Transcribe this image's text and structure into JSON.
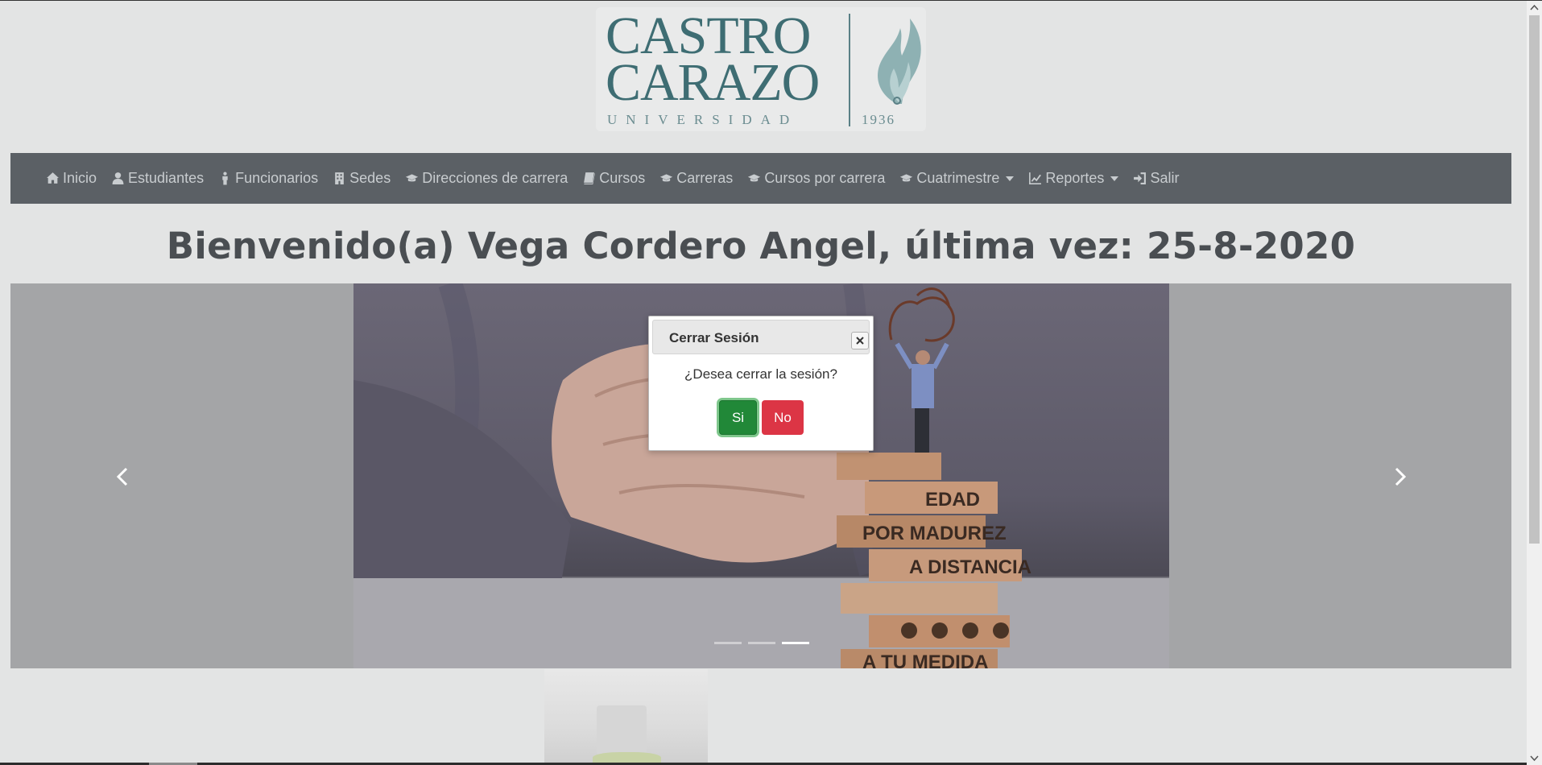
{
  "logo": {
    "line1": "CASTRO",
    "line2": "CARAZO",
    "subtitle": "UNIVERSIDAD",
    "year": "1936"
  },
  "nav": {
    "items": [
      {
        "label": "Inicio",
        "icon": "home-icon"
      },
      {
        "label": "Estudiantes",
        "icon": "user-icon"
      },
      {
        "label": "Funcionarios",
        "icon": "person-icon"
      },
      {
        "label": "Sedes",
        "icon": "building-icon"
      },
      {
        "label": "Direcciones de carrera",
        "icon": "graduation-cap-icon"
      },
      {
        "label": "Cursos",
        "icon": "book-icon"
      },
      {
        "label": "Carreras",
        "icon": "graduation-cap-icon"
      },
      {
        "label": "Cursos por carrera",
        "icon": "graduation-cap-icon"
      },
      {
        "label": "Cuatrimestre",
        "icon": "graduation-cap-icon",
        "dropdown": true
      },
      {
        "label": "Reportes",
        "icon": "line-chart-icon",
        "dropdown": true
      },
      {
        "label": "Salir",
        "icon": "sign-in-icon"
      }
    ]
  },
  "welcome": "Bienvenido(a) Vega Cordero Angel, última vez: 25-8-2020",
  "carousel": {
    "slide_texts": [
      "EDAD",
      "POR MADUREZ",
      "A DISTANCIA",
      "A TU MEDIDA"
    ],
    "indicators": 3,
    "active_indicator": 3
  },
  "modal": {
    "title": "Cerrar Sesión",
    "message": "¿Desea cerrar la sesión?",
    "yes_label": "Si",
    "no_label": "No"
  },
  "colors": {
    "navbar": "#5b6065",
    "logo": "#3e6d73",
    "yes_button": "#218838",
    "no_button": "#dc3545"
  }
}
